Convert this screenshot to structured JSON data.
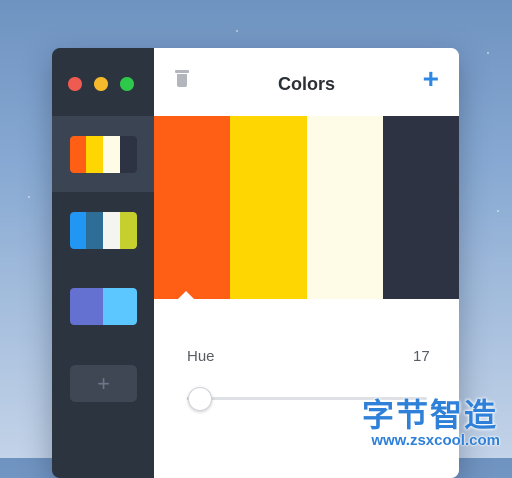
{
  "window": {
    "title": "Colors"
  },
  "toolbar": {
    "delete_icon": "trash-icon",
    "add_icon": "plus-icon",
    "add_label": "+"
  },
  "palettes": [
    {
      "colors": [
        "#fe5f14",
        "#fed602",
        "#fefbe6",
        "#2d3343"
      ],
      "selected": true
    },
    {
      "colors": [
        "#2196f3",
        "#2e6d96",
        "#f4f4f0",
        "#c5cf2d"
      ],
      "selected": false
    },
    {
      "colors": [
        "#6571d0",
        "#5cc7ff"
      ],
      "selected": false
    }
  ],
  "sidebar": {
    "add_label": "+"
  },
  "current_palette": {
    "colors": [
      "#fe5f14",
      "#fed602",
      "#fefbe6",
      "#2d3343"
    ]
  },
  "hue": {
    "label": "Hue",
    "value": "17",
    "fraction": 0.05
  },
  "watermark": {
    "title": "字节智造",
    "url": "www.zsxcool.com"
  }
}
